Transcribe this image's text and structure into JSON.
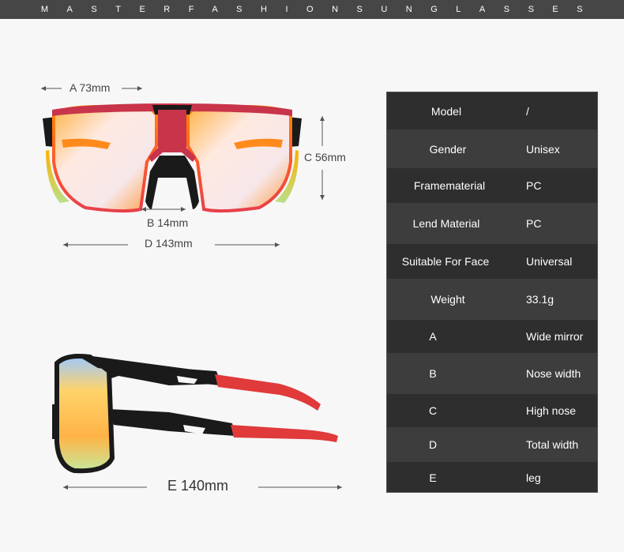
{
  "banner": "MASTERFASHIONSUNGLASSES",
  "dimensions": {
    "a": "A 73mm",
    "b": "B 14mm",
    "c": "C 56mm",
    "d": "D 143mm",
    "e": "E 140mm"
  },
  "specs": [
    {
      "key": "Model",
      "value": "/"
    },
    {
      "key": "Gender",
      "value": "Unisex"
    },
    {
      "key": "Framematerial",
      "value": "PC"
    },
    {
      "key": "Lend Material",
      "value": "PC"
    },
    {
      "key": "Suitable For Face",
      "value": "Universal"
    },
    {
      "key": "Weight",
      "value": "33.1g"
    },
    {
      "key": "A",
      "value": "Wide mirror"
    },
    {
      "key": "B",
      "value": "Nose width"
    },
    {
      "key": "C",
      "value": "High nose"
    },
    {
      "key": "D",
      "value": "Total width"
    },
    {
      "key": "E",
      "value": "leg"
    }
  ],
  "colors": {
    "banner": "#464646",
    "table_dark": "#2e2e2e",
    "table_mid": "#3d3d3d",
    "frame_red": "#c8344a",
    "temple_red": "#e03a3a"
  }
}
